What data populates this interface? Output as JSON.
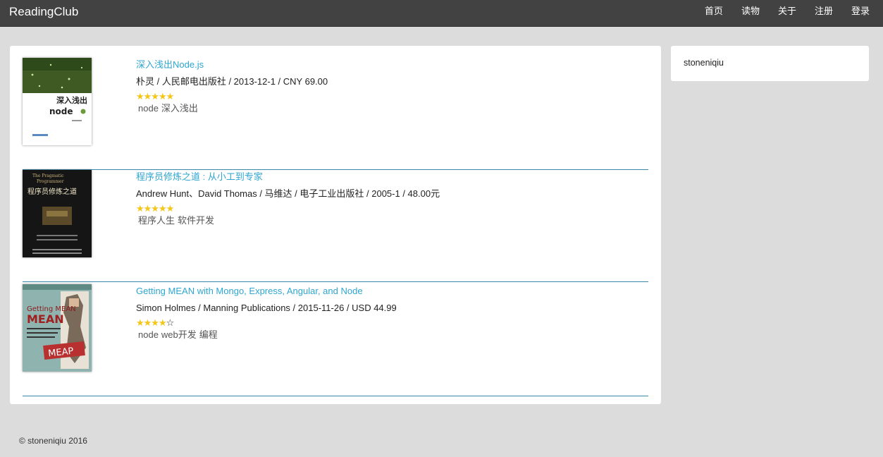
{
  "nav": {
    "brand": "ReadingClub",
    "items": [
      "首页",
      "读物",
      "关于",
      "注册",
      "登录"
    ]
  },
  "books": [
    {
      "title": "深入浅出Node.js",
      "meta": "朴灵 / 人民邮电出版社 / 2013-12-1 / CNY 69.00",
      "rating": 5,
      "tags": [
        "node",
        "深入浅出"
      ],
      "cover_text": "深入浅出"
    },
    {
      "title": "程序员修炼之道 : 从小工到专家",
      "meta": "Andrew Hunt、David Thomas / 马维达 / 电子工业出版社 / 2005-1 / 48.00元",
      "rating": 5,
      "tags": [
        "程序人生",
        "软件开发"
      ],
      "cover_text": "程序员修炼之道"
    },
    {
      "title": "Getting MEAN with Mongo, Express, Angular, and Node",
      "meta": "Simon Holmes / Manning Publications / 2015-11-26 / USD 44.99",
      "rating": 4,
      "tags": [
        "node",
        "web开发",
        "编程"
      ],
      "cover_text": "Getting MEAN"
    }
  ],
  "sidebar": {
    "username": "stoneniqiu"
  },
  "footer": {
    "text": "© stoneniqiu 2016"
  },
  "colors": {
    "navbar": "#424242",
    "link": "#2ea6cf",
    "star": "#f5c518",
    "divider": "#3a87a8"
  }
}
